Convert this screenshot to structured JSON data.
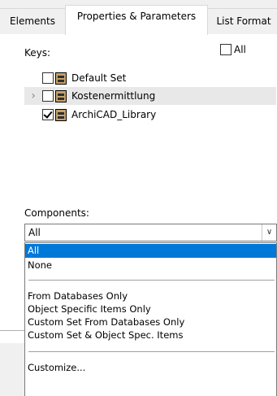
{
  "tabs": [
    {
      "label": "Elements"
    },
    {
      "label": "Properties & Parameters"
    },
    {
      "label": "List Format"
    }
  ],
  "keys": {
    "label": "Keys:",
    "all_label": "All",
    "all_checked": false,
    "items": [
      {
        "label": "Default Set",
        "checked": false,
        "expandable": false
      },
      {
        "label": "Kostenermittlung",
        "checked": false,
        "expandable": true,
        "selected": true
      },
      {
        "label": "ArchiCAD_Library",
        "checked": true,
        "expandable": false
      }
    ]
  },
  "components": {
    "label": "Components:",
    "selected": "All",
    "arrow": "chevron-down-icon",
    "options_group1": [
      "All",
      "None"
    ],
    "options_group2": [
      "From Databases Only",
      "Object Specific Items Only",
      "Custom Set From Databases Only",
      "Custom Set & Object Spec. Items"
    ],
    "options_group3": [
      "Customize..."
    ],
    "highlight_color": "#0078d7"
  }
}
